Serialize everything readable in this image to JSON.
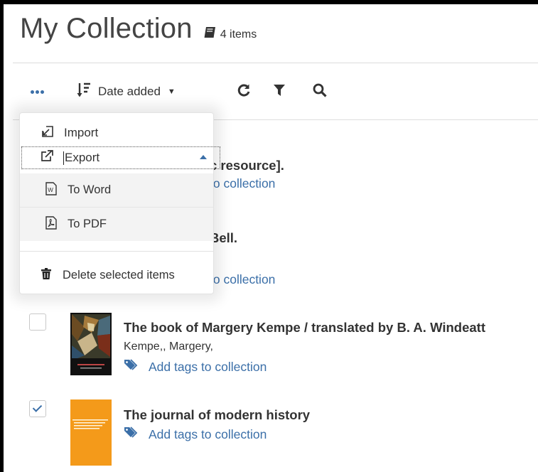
{
  "header": {
    "title": "My Collection",
    "items_count": "4 items",
    "book_icon": "book-icon"
  },
  "toolbar": {
    "more_icon": "ellipsis-icon",
    "sort_label": "Date added",
    "sort_icon": "sort-descending-icon",
    "refresh_icon": "refresh-icon",
    "filter_icon": "filter-icon",
    "search_icon": "search-icon"
  },
  "menu": {
    "import_label": "Import",
    "export_label": "Export",
    "to_word_label": "To Word",
    "to_pdf_label": "To PDF",
    "delete_label": "Delete selected items"
  },
  "items": [
    {
      "title_visible": "c resource].",
      "tags_visible": "to collection",
      "checked": false
    },
    {
      "title_visible": "Bell.",
      "tags_visible": "to collection",
      "checked": false
    },
    {
      "title": "The book of Margery Kempe / translated by B. A. Windeatt",
      "author": "Kempe,, Margery,",
      "tags": "Add tags to collection",
      "checked": false
    },
    {
      "title": "The journal of modern history",
      "tags": "Add tags to collection",
      "checked": true
    }
  ],
  "colors": {
    "accent": "#3b6fa8",
    "journal_cover": "#f49a1a"
  }
}
